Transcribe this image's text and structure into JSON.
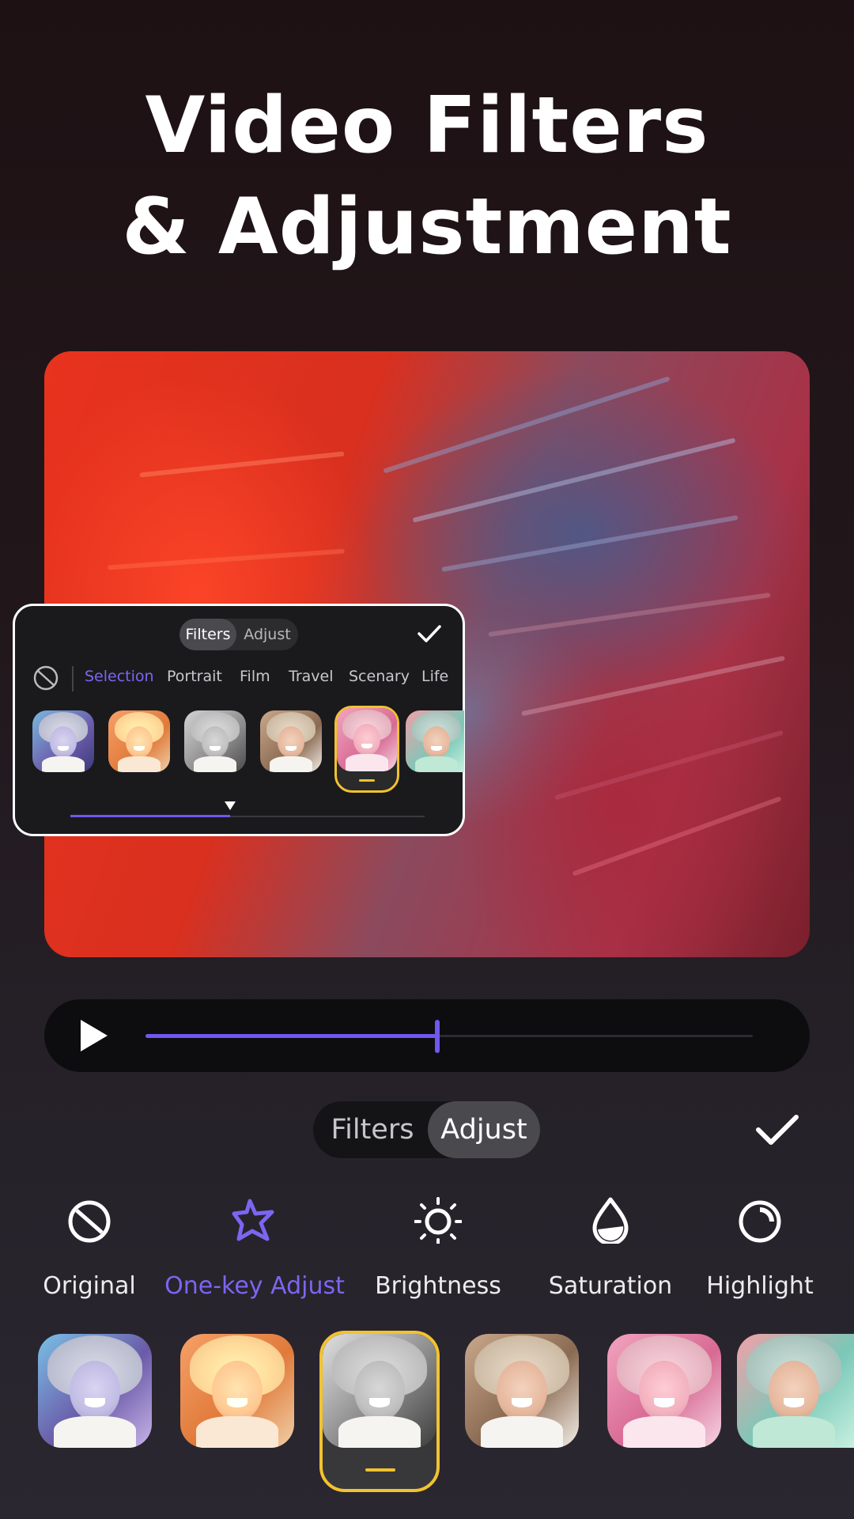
{
  "headline": {
    "line1": "Video Filters",
    "line2": "& Adjustment"
  },
  "mini_panel": {
    "tabs": [
      "Filters",
      "Adjust"
    ],
    "active_tab": "Filters",
    "categories": [
      "Selection",
      "Portrait",
      "Film",
      "Travel",
      "Scenary",
      "Life"
    ],
    "active_category": "Selection",
    "thumbnails": [
      {
        "style": "cool-purple"
      },
      {
        "style": "warm-orange"
      },
      {
        "style": "black-white",
        "selected": false
      },
      {
        "style": "natural"
      },
      {
        "style": "pink",
        "selected": true
      },
      {
        "style": "teal"
      }
    ],
    "slider_value": 0.45
  },
  "playback": {
    "progress": 0.48
  },
  "toggle": {
    "filters": "Filters",
    "adjust": "Adjust",
    "active": "Adjust"
  },
  "tools": [
    {
      "label": "Original",
      "icon": "ban-icon"
    },
    {
      "label": "One-key Adjust",
      "icon": "star-icon",
      "active": true
    },
    {
      "label": "Brightness",
      "icon": "sun-icon"
    },
    {
      "label": "Saturation",
      "icon": "droplet-icon"
    },
    {
      "label": "Highlight",
      "icon": "highlight-icon"
    }
  ],
  "bottom_thumbnails": [
    {
      "style": "cool-purple"
    },
    {
      "style": "warm-orange"
    },
    {
      "style": "black-white",
      "selected": true
    },
    {
      "style": "natural"
    },
    {
      "style": "pink"
    },
    {
      "style": "teal"
    }
  ],
  "colors": {
    "accent": "#6f58ee",
    "selection": "#f2c230",
    "active_text": "#7b66f2"
  }
}
